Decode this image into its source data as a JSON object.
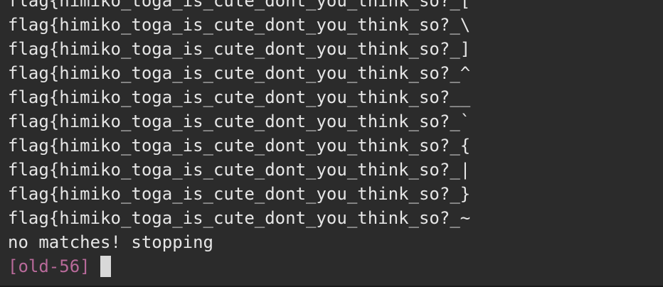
{
  "terminal": {
    "lines": [
      "flag{himiko_toga_is_cute_dont_you_think_so?_[",
      "flag{himiko_toga_is_cute_dont_you_think_so?_\\",
      "flag{himiko_toga_is_cute_dont_you_think_so?_]",
      "flag{himiko_toga_is_cute_dont_you_think_so?_^",
      "flag{himiko_toga_is_cute_dont_you_think_so?__",
      "flag{himiko_toga_is_cute_dont_you_think_so?_`",
      "flag{himiko_toga_is_cute_dont_you_think_so?_{",
      "flag{himiko_toga_is_cute_dont_you_think_so?_|",
      "flag{himiko_toga_is_cute_dont_you_think_so?_}",
      "flag{himiko_toga_is_cute_dont_you_think_so?_~",
      "no matches! stopping"
    ],
    "prompt": "[old-56]",
    "colors": {
      "background": "#2b2b2b",
      "text": "#e6e6e6",
      "prompt": "#b86a9a",
      "cursor": "#d9d9d9"
    }
  }
}
